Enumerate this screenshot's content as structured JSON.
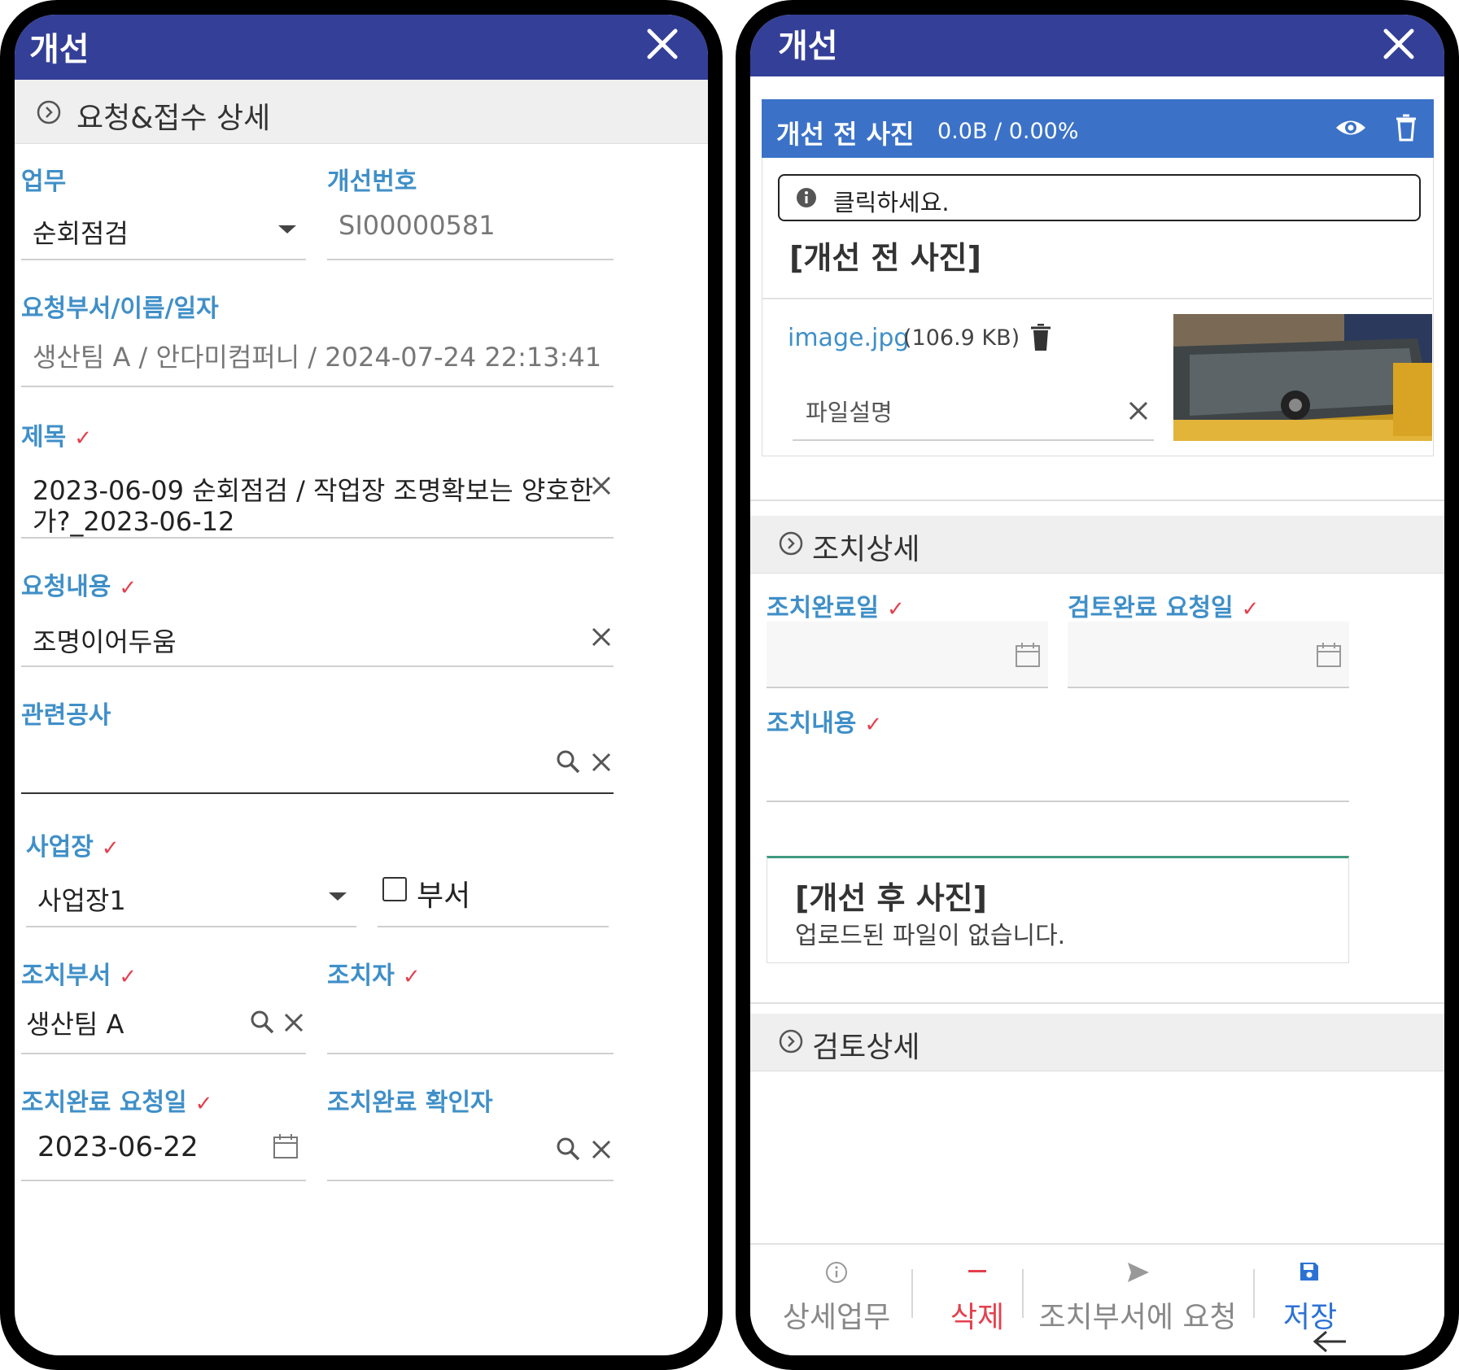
{
  "left": {
    "title": "개선",
    "section": "요청&접수 상세",
    "fields": {
      "task_label": "업무",
      "task_value": "순회점검",
      "number_label": "개선번호",
      "number_value": "SI00000581",
      "requester_label": "요청부서/이름/일자",
      "requester_value": "생산팀 A / 안다미컴퍼니 / 2024-07-24 22:13:41",
      "subject_label": "제목",
      "subject_value_line1": "2023-06-09 순회점검 / 작업장 조명확보는 양호한",
      "subject_value_line2": "가?_2023-06-12",
      "content_label": "요청내용",
      "content_value": "조명이어두움",
      "project_label": "관련공사",
      "site_label": "사업장",
      "site_value": "사업장1",
      "dept_checkbox_label": "부서",
      "action_dept_label": "조치부서",
      "action_dept_value": "생산팀 A",
      "actor_label": "조치자",
      "due_label": "조치완료 요청일",
      "due_value": "2023-06-22",
      "confirmer_label": "조치완료 확인자"
    }
  },
  "right": {
    "title": "개선",
    "before_photo": {
      "bar_title": "개선 전 사진",
      "progress": "0.0B / 0.00%",
      "hint": "클릭하세요.",
      "heading": "[개선 전 사진]",
      "file_name": "image.jpg",
      "file_size": "(106.9 KB)",
      "desc_placeholder": "파일설명"
    },
    "action_section": "조치상세",
    "action_done_label": "조치완료일",
    "review_request_label": "검토완료 요청일",
    "action_content_label": "조치내용",
    "after_photo": {
      "heading": "[개선 후 사진]",
      "empty": "업로드된 파일이 없습니다."
    },
    "review_section": "검토상세",
    "bottom": {
      "detail": "상세업무",
      "delete": "삭제",
      "request": "조치부서에 요청",
      "save": "저장"
    },
    "colors": {
      "appbar": "#343f98",
      "label": "#3f8fc8",
      "delete": "#e4404d",
      "save": "#2c72d4",
      "upload_bar": "#3b72c8"
    }
  }
}
